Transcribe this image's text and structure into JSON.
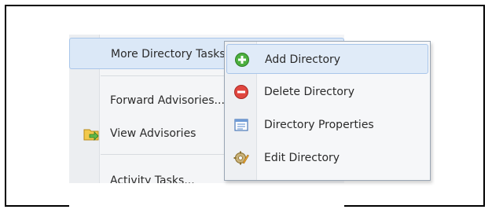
{
  "background_menu": {
    "items": [
      {
        "label": "More Directory Tasks..."
      },
      {
        "label": "Forward Advisories..."
      },
      {
        "label": "View Advisories"
      },
      {
        "label": "Activity Tasks..."
      }
    ]
  },
  "submenu": {
    "items": [
      {
        "label": "Add Directory",
        "icon": "add-icon"
      },
      {
        "label": "Delete Directory",
        "icon": "delete-icon"
      },
      {
        "label": "Directory Properties",
        "icon": "properties-icon"
      },
      {
        "label": "Edit Directory",
        "icon": "edit-gear-icon"
      }
    ]
  },
  "colors": {
    "hover_bg": "#dbe8f7",
    "hover_border": "#a9c6ea",
    "add_green": "#4caf3f",
    "delete_red": "#e0463f"
  }
}
